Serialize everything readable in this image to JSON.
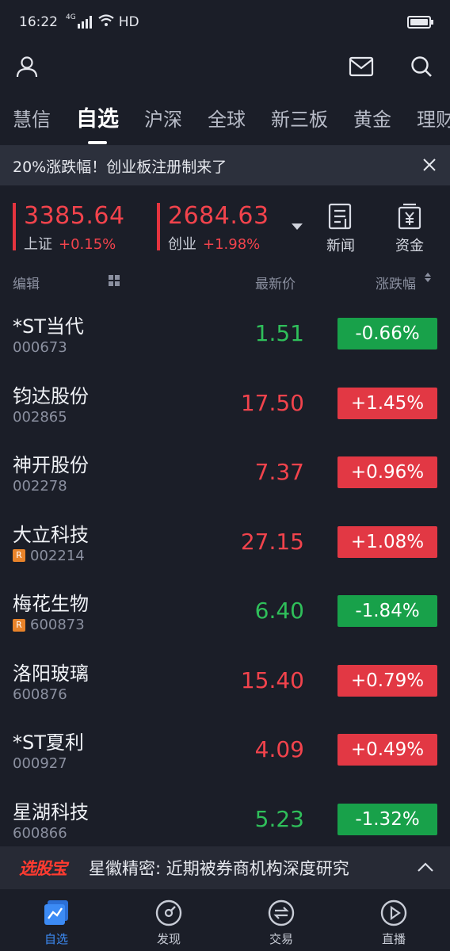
{
  "status_bar": {
    "time": "16:22",
    "network": "4G",
    "hd": "HD"
  },
  "tabs": [
    {
      "label": "慧信"
    },
    {
      "label": "自选"
    },
    {
      "label": "沪深"
    },
    {
      "label": "全球"
    },
    {
      "label": "新三板"
    },
    {
      "label": "黄金"
    },
    {
      "label": "理财"
    }
  ],
  "active_tab": "自选",
  "banner": {
    "text": "20%涨跌幅！创业板注册制来了"
  },
  "indices": [
    {
      "value": "3385.64",
      "name": "上证",
      "change": "+0.15%"
    },
    {
      "value": "2684.63",
      "name": "创业",
      "change": "+1.98%"
    }
  ],
  "shortcuts": {
    "news": "新闻",
    "funds": "资金"
  },
  "columns": {
    "edit": "编辑",
    "latest_price": "最新价",
    "change_pct": "涨跌幅"
  },
  "stocks": [
    {
      "name": "*ST当代",
      "code": "000673",
      "price": "1.51",
      "change": "-0.66%",
      "dir": "down",
      "r": false
    },
    {
      "name": "钧达股份",
      "code": "002865",
      "price": "17.50",
      "change": "+1.45%",
      "dir": "up",
      "r": false
    },
    {
      "name": "神开股份",
      "code": "002278",
      "price": "7.37",
      "change": "+0.96%",
      "dir": "up",
      "r": false
    },
    {
      "name": "大立科技",
      "code": "002214",
      "price": "27.15",
      "change": "+1.08%",
      "dir": "up",
      "r": true
    },
    {
      "name": "梅花生物",
      "code": "600873",
      "price": "6.40",
      "change": "-1.84%",
      "dir": "down",
      "r": true
    },
    {
      "name": "洛阳玻璃",
      "code": "600876",
      "price": "15.40",
      "change": "+0.79%",
      "dir": "up",
      "r": false
    },
    {
      "name": "*ST夏利",
      "code": "000927",
      "price": "4.09",
      "change": "+0.49%",
      "dir": "up",
      "r": false
    },
    {
      "name": "星湖科技",
      "code": "600866",
      "price": "5.23",
      "change": "-1.32%",
      "dir": "down",
      "r": false
    }
  ],
  "r_badge": "R",
  "promo": {
    "logo": "选股宝",
    "text": "星徽精密: 近期被券商机构深度研究"
  },
  "bottom_nav": [
    {
      "label": "自选",
      "icon": "watchlist-chart-icon"
    },
    {
      "label": "发现",
      "icon": "compass-icon"
    },
    {
      "label": "交易",
      "icon": "exchange-icon"
    },
    {
      "label": "直播",
      "icon": "play-icon"
    }
  ],
  "colors": {
    "background": "#1b1e28",
    "up": "#f2434c",
    "down": "#2fbf5a",
    "accent": "#3c8bf5"
  }
}
